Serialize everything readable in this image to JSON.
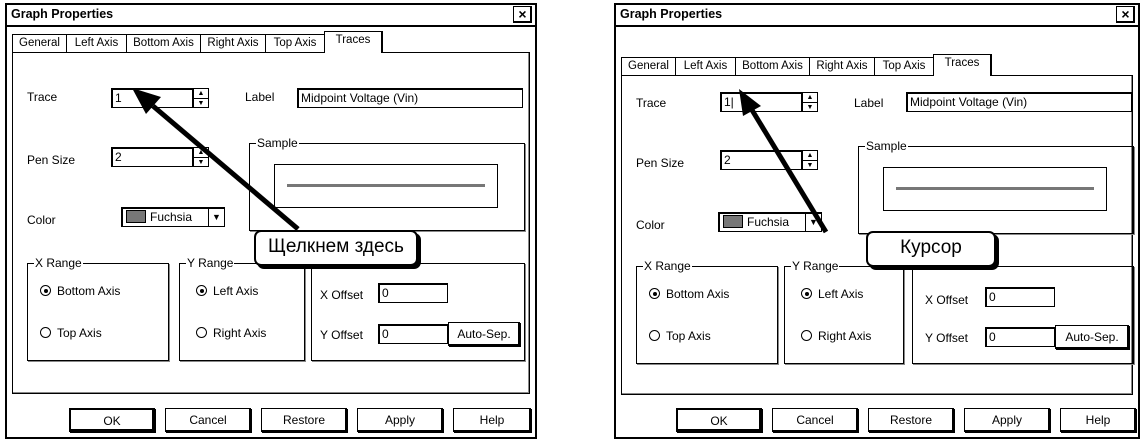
{
  "dialog": {
    "title": "Graph Properties",
    "close": "×",
    "tabs": [
      "General",
      "Left Axis",
      "Bottom Axis",
      "Right Axis",
      "Top Axis",
      "Traces"
    ],
    "trace_label": "Trace",
    "label_label": "Label",
    "label_value": "Midpoint Voltage (Vin)",
    "pen_size_label": "Pen Size",
    "pen_size_value": "2",
    "sample_label": "Sample",
    "color_label": "Color",
    "color_value": "Fuchsia",
    "swatch_color": "#777777",
    "xrange_label": "X Range",
    "xrange_opts": [
      "Bottom Axis",
      "Top Axis"
    ],
    "yrange_label": "Y Range",
    "yrange_opts": [
      "Left Axis",
      "Right Axis"
    ],
    "xoffset_label": "X Offset",
    "xoffset_value": "0",
    "yoffset_label": "Y Offset",
    "yoffset_value": "0",
    "autosep": "Auto-Sep.",
    "buttons": [
      "OK",
      "Cancel",
      "Restore",
      "Apply",
      "Help"
    ]
  },
  "left": {
    "trace_value": "1",
    "callout": "Щелкнем здесь"
  },
  "right": {
    "trace_value": "1|",
    "callout": "Курсор"
  }
}
